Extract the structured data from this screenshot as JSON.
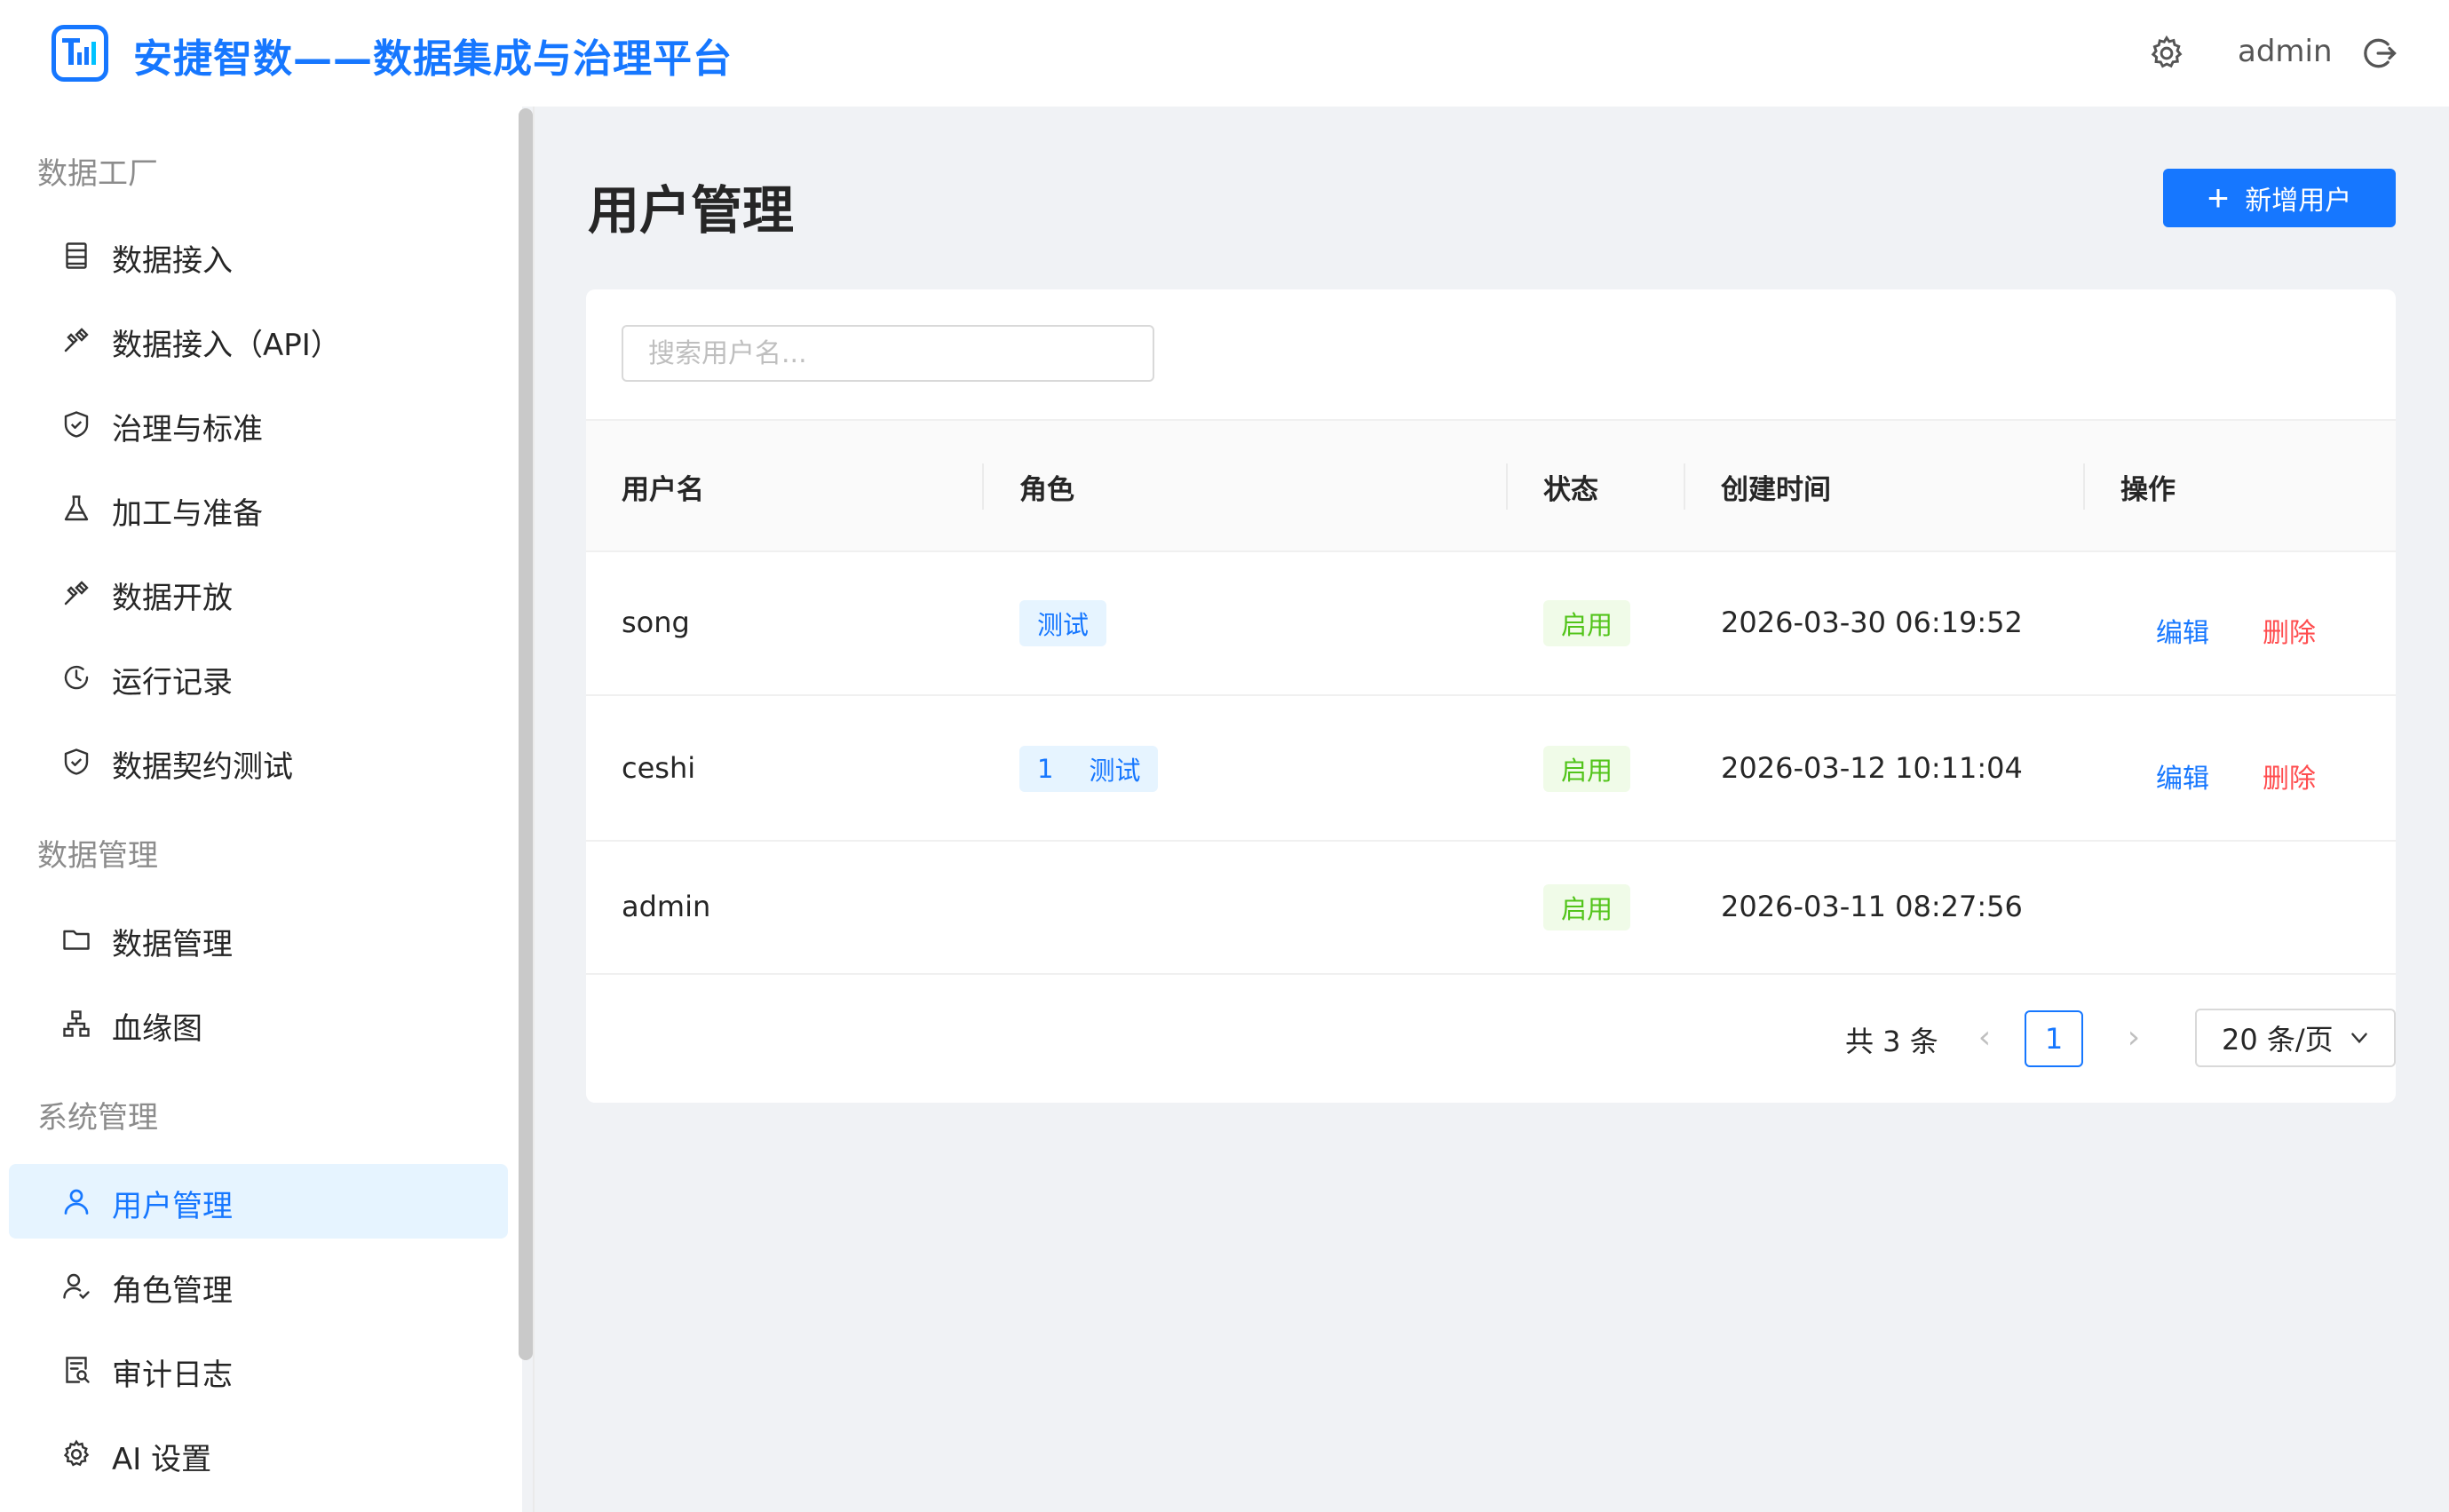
{
  "header": {
    "app_title": "安捷智数——数据集成与治理平台",
    "username": "admin",
    "settings_icon": "gear-icon",
    "logout_icon": "logout-icon",
    "accent": "#1677ff"
  },
  "sidebar": {
    "groups": [
      {
        "label": "数据工厂",
        "items": [
          {
            "label": "数据接入",
            "icon": "data-sheet-icon"
          },
          {
            "label": "数据接入（API）",
            "icon": "api-plug-icon"
          },
          {
            "label": "治理与标准",
            "icon": "shield-check-icon"
          },
          {
            "label": "加工与准备",
            "icon": "flask-icon"
          },
          {
            "label": "数据开放",
            "icon": "api-plug-icon"
          },
          {
            "label": "运行记录",
            "icon": "clock-icon"
          },
          {
            "label": "数据契约测试",
            "icon": "shield-check-icon"
          }
        ]
      },
      {
        "label": "数据管理",
        "items": [
          {
            "label": "数据管理",
            "icon": "folder-icon"
          },
          {
            "label": "血缘图",
            "icon": "lineage-icon"
          }
        ]
      },
      {
        "label": "系统管理",
        "items": [
          {
            "label": "用户管理",
            "icon": "user-icon",
            "active": true
          },
          {
            "label": "角色管理",
            "icon": "role-icon"
          },
          {
            "label": "审计日志",
            "icon": "audit-log-icon"
          },
          {
            "label": "AI 设置",
            "icon": "gear-icon"
          }
        ]
      }
    ]
  },
  "main": {
    "page_title": "用户管理",
    "add_button": "新增用户",
    "search_placeholder": "搜索用户名...",
    "columns": [
      "用户名",
      "角色",
      "状态",
      "创建时间",
      "操作"
    ],
    "rows": [
      {
        "username": "song",
        "roles": [
          "测试"
        ],
        "status": "启用",
        "created": "2026-03-30 06:19:52",
        "actions": [
          "编辑",
          "删除"
        ]
      },
      {
        "username": "ceshi",
        "roles": [
          "1",
          "测试"
        ],
        "status": "启用",
        "created": "2026-03-12 10:11:04",
        "actions": [
          "编辑",
          "删除"
        ]
      },
      {
        "username": "admin",
        "roles": [],
        "status": "启用",
        "created": "2026-03-11 08:27:56",
        "actions": []
      }
    ],
    "pagination": {
      "total_text": "共 3 条",
      "current_page": "1",
      "page_size": "20 条/页"
    }
  }
}
